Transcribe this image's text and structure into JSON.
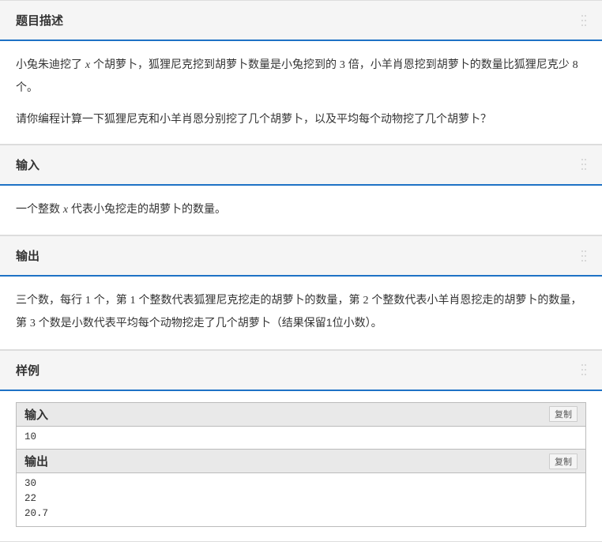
{
  "sections": {
    "description": {
      "title": "题目描述",
      "para1_pre": "小兔朱迪挖了 ",
      "para1_var": "x",
      "para1_mid1": " 个胡萝卜，狐狸尼克挖到胡萝卜数量是小兔挖到的 ",
      "para1_num1": "3",
      "para1_mid2": " 倍，小羊肖恩挖到胡萝卜的数量比狐狸尼克少 ",
      "para1_num2": "8",
      "para1_end": " 个。",
      "para2": "请你编程计算一下狐狸尼克和小羊肖恩分别挖了几个胡萝卜，以及平均每个动物挖了几个胡萝卜？"
    },
    "input": {
      "title": "输入",
      "para_pre": "一个整数 ",
      "para_var": "x",
      "para_post": " 代表小兔挖走的胡萝卜的数量。"
    },
    "output": {
      "title": "输出",
      "para_pre": "三个数，每行 ",
      "n1": "1",
      "para_m1": " 个，第 ",
      "n2": "1",
      "para_m2": " 个整数代表狐狸尼克挖走的胡萝卜的数量，第 ",
      "n3": "2",
      "para_m3": " 个整数代表小羊肖恩挖走的胡萝卜的数量，第 ",
      "n4": "3",
      "para_end": " 个数是小数代表平均每个动物挖走了几个胡萝卜（结果保留1位小数）。"
    },
    "sample": {
      "title": "样例",
      "input_label": "输入",
      "output_label": "输出",
      "copy_label": "复制",
      "input_data": "10",
      "output_data": "30\n22\n20.7"
    }
  }
}
